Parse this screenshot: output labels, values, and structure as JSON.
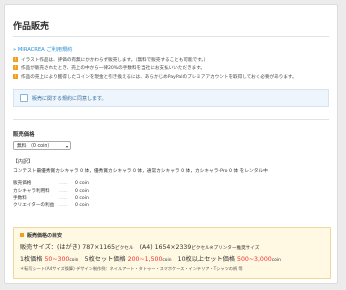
{
  "page": {
    "title": "作品販売",
    "terms_link": "» MIRACREA ご利用規約",
    "notes": [
      "イラスト作品は、評価の有無にかかわらず販売します。（無料で販売することも可能です。）",
      "作品が販売されたとき、売上の中から一律20%の手数料を当社にお支払いいただきます。",
      "作品の売上により獲得したコインを現金と引き換えるには、あらかじめPayPalのプレミアアカウントを取得しておく必要があります。"
    ],
    "agree_label": "販売に関する規約に同意します。"
  },
  "pricing": {
    "section_title": "販売価格",
    "select_value": "無料 （0 coin）",
    "content_heading": "【内訳】",
    "content_text": "コンテスト最優秀賞カシキャラ 0 体，優秀賞カシキャラ 0 体，通常カシキャラ 0 体，カシキャラ-Pro 0 体 をレンタル中",
    "rows": [
      {
        "label": "販売価格",
        "dots": "......",
        "value": "0 coin"
      },
      {
        "label": "カシキャラ利用料",
        "dots": "......",
        "value": "0 coin"
      },
      {
        "label": "手数料",
        "dots": "......",
        "value": "0 coin"
      },
      {
        "label": "クリエイターの利益",
        "dots": "......",
        "value": "0 coin"
      }
    ]
  },
  "guide": {
    "title": "販売価格の目安",
    "size_main": "販売サイズ：(はがき) 787×1165",
    "size_unit1": "ピクセル",
    "size_mid": "　(A4) 1654×2339",
    "size_unit2": "ピクセル",
    "size_tail": "※プリンター推奨サイズ",
    "p1_label": "1枚価格 ",
    "p1_val": "50~300",
    "p1_unit": "coin",
    "p2_label": "　5枚セット価格 ",
    "p2_val": "200~1,500",
    "p2_unit": "coin",
    "p3_label": "　10枚以上セット価格 ",
    "p3_val": "500~3,000",
    "p3_unit": "coin",
    "note": "＊転写シート(A4サイズ換算) デザイン制作例：ネイルアート・タトゥー・スマホケース・インテリア・Tシャツの柄 等"
  },
  "colors": {
    "accent": "#2a8fd6",
    "price": "#e33333",
    "bullet": "#f0a020"
  }
}
